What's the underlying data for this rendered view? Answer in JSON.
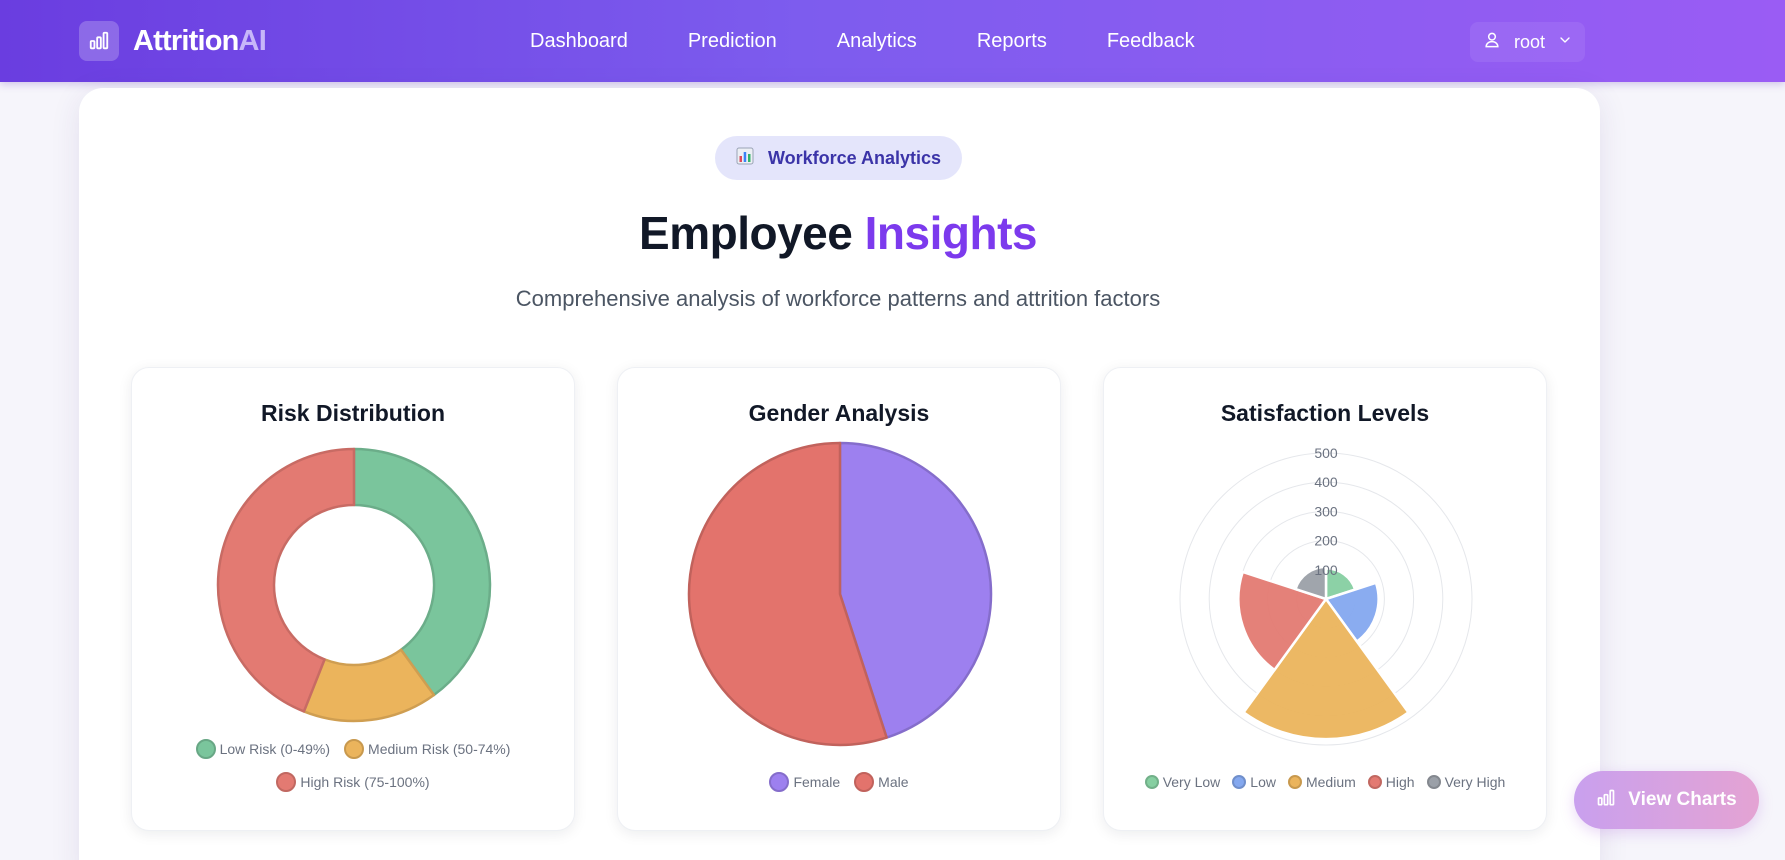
{
  "brand": {
    "name_main": "Attrition",
    "name_accent": "AI",
    "icon": "bar-chart-icon"
  },
  "nav": {
    "links": [
      "Dashboard",
      "Prediction",
      "Analytics",
      "Reports",
      "Feedback"
    ]
  },
  "user": {
    "name": "root",
    "icon": "user-icon"
  },
  "hero": {
    "badge_icon": "bar-chart-emoji-icon",
    "badge_text": "Workforce Analytics",
    "title_main": "Employee",
    "title_accent": "Insights",
    "subtitle": "Comprehensive analysis of workforce patterns and attrition factors"
  },
  "colors": {
    "low": "#7ac59c",
    "medium": "#ebb45c",
    "high": "#e37a72",
    "female": "#9d80ef",
    "male": "#e3736c",
    "very_low": "#86cfa1",
    "low_sat": "#84a8ef",
    "very_high": "#9ba0a8",
    "accent": "#7c3aed"
  },
  "charts": {
    "risk": {
      "title": "Risk Distribution"
    },
    "gender": {
      "title": "Gender Analysis"
    },
    "satisfaction": {
      "title": "Satisfaction Levels"
    }
  },
  "chart_data": [
    {
      "type": "pie",
      "variant": "doughnut",
      "title": "Risk Distribution",
      "labels": [
        "Low Risk (0-49%)",
        "Medium Risk (50-74%)",
        "High Risk (75-100%)"
      ],
      "values": [
        40,
        16,
        44
      ],
      "legend": "bottom"
    },
    {
      "type": "pie",
      "title": "Gender Analysis",
      "labels": [
        "Female",
        "Male"
      ],
      "values": [
        45,
        55
      ],
      "legend": "bottom"
    },
    {
      "type": "polarArea",
      "title": "Satisfaction Levels",
      "labels": [
        "Very Low",
        "Low",
        "Medium",
        "High",
        "Very High"
      ],
      "values": [
        105,
        180,
        480,
        300,
        110
      ],
      "r_ticks": [
        100,
        200,
        300,
        400,
        500
      ],
      "r_max": 500,
      "legend": "bottom"
    }
  ],
  "fab": {
    "label": "View Charts",
    "icon": "bar-chart-icon"
  }
}
